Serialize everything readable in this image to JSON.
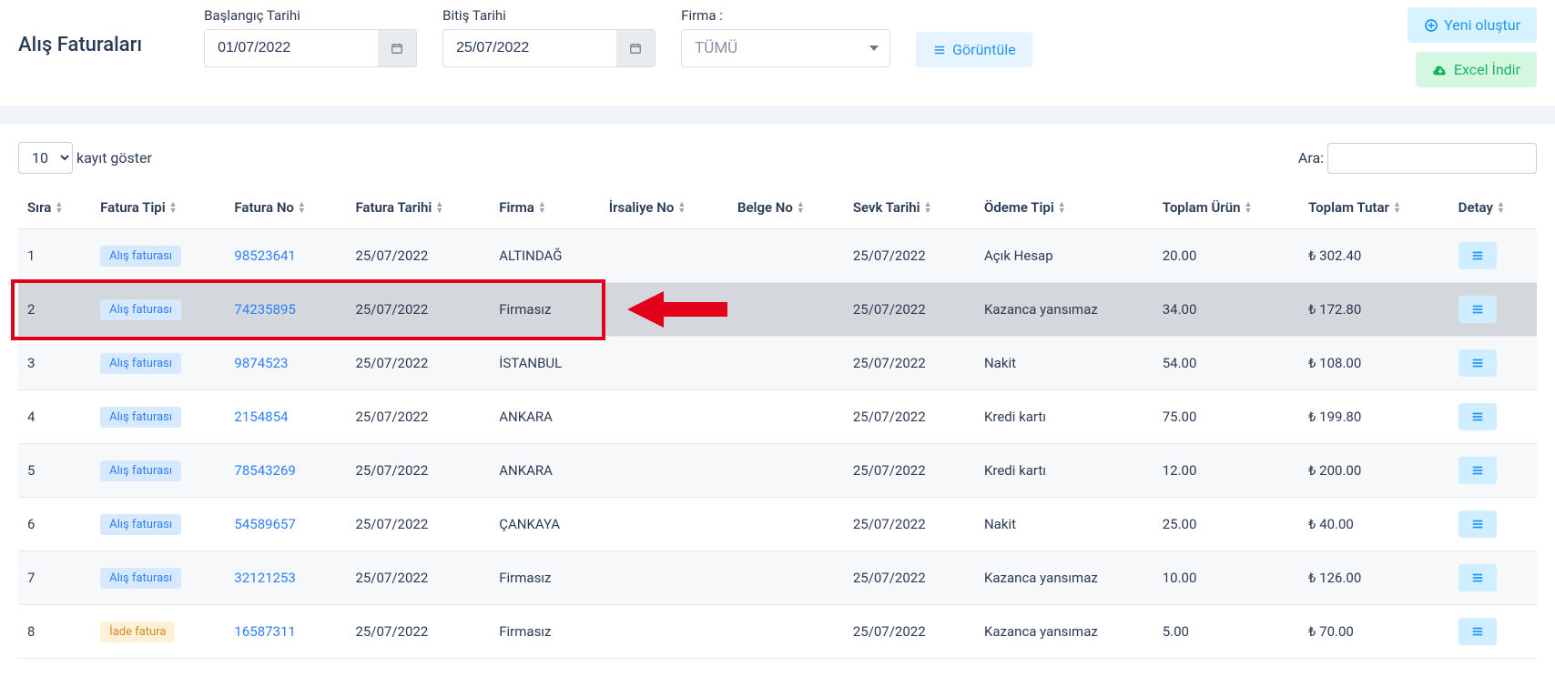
{
  "header": {
    "title": "Alış Faturaları",
    "start_label": "Başlangıç Tarihi",
    "end_label": "Bitiş Tarihi",
    "company_label": "Firma :",
    "start_value": "01/07/2022",
    "end_value": "25/07/2022",
    "company_selected": "TÜMÜ",
    "view_btn": "Görüntüle",
    "create_btn": "Yeni oluştur",
    "excel_btn": "Excel İndir"
  },
  "table_controls": {
    "length": "10",
    "length_suffix": "kayıt göster",
    "search_label": "Ara:"
  },
  "columns": [
    "Sıra",
    "Fatura Tipi",
    "Fatura No",
    "Fatura Tarihi",
    "Firma",
    "İrsaliye No",
    "Belge No",
    "Sevk Tarihi",
    "Ödeme Tipi",
    "Toplam Ürün",
    "Toplam Tutar",
    "Detay"
  ],
  "rows": [
    {
      "sira": "1",
      "tip": "Alış faturası",
      "tip_kind": "blue",
      "no": "98523641",
      "tarih": "25/07/2022",
      "firma": "ALTINDAĞ",
      "irsaliye": "",
      "belge": "",
      "sevk": "25/07/2022",
      "odeme": "Açık Hesap",
      "urun": "20.00",
      "tutar": "₺ 302.40",
      "highlight": false
    },
    {
      "sira": "2",
      "tip": "Alış faturası",
      "tip_kind": "blue",
      "no": "74235895",
      "tarih": "25/07/2022",
      "firma": "Firmasız",
      "irsaliye": "",
      "belge": "",
      "sevk": "25/07/2022",
      "odeme": "Kazanca yansımaz",
      "urun": "34.00",
      "tutar": "₺ 172.80",
      "highlight": true
    },
    {
      "sira": "3",
      "tip": "Alış faturası",
      "tip_kind": "blue",
      "no": "9874523",
      "tarih": "25/07/2022",
      "firma": "İSTANBUL",
      "irsaliye": "",
      "belge": "",
      "sevk": "25/07/2022",
      "odeme": "Nakit",
      "urun": "54.00",
      "tutar": "₺ 108.00",
      "highlight": false
    },
    {
      "sira": "4",
      "tip": "Alış faturası",
      "tip_kind": "blue",
      "no": "2154854",
      "tarih": "25/07/2022",
      "firma": "ANKARA",
      "irsaliye": "",
      "belge": "",
      "sevk": "25/07/2022",
      "odeme": "Kredi kartı",
      "urun": "75.00",
      "tutar": "₺ 199.80",
      "highlight": false
    },
    {
      "sira": "5",
      "tip": "Alış faturası",
      "tip_kind": "blue",
      "no": "78543269",
      "tarih": "25/07/2022",
      "firma": "ANKARA",
      "irsaliye": "",
      "belge": "",
      "sevk": "25/07/2022",
      "odeme": "Kredi kartı",
      "urun": "12.00",
      "tutar": "₺ 200.00",
      "highlight": false
    },
    {
      "sira": "6",
      "tip": "Alış faturası",
      "tip_kind": "blue",
      "no": "54589657",
      "tarih": "25/07/2022",
      "firma": "ÇANKAYA",
      "irsaliye": "",
      "belge": "",
      "sevk": "25/07/2022",
      "odeme": "Nakit",
      "urun": "25.00",
      "tutar": "₺ 40.00",
      "highlight": false
    },
    {
      "sira": "7",
      "tip": "Alış faturası",
      "tip_kind": "blue",
      "no": "32121253",
      "tarih": "25/07/2022",
      "firma": "Firmasız",
      "irsaliye": "",
      "belge": "",
      "sevk": "25/07/2022",
      "odeme": "Kazanca yansımaz",
      "urun": "10.00",
      "tutar": "₺ 126.00",
      "highlight": false
    },
    {
      "sira": "8",
      "tip": "İade fatura",
      "tip_kind": "orange",
      "no": "16587311",
      "tarih": "25/07/2022",
      "firma": "Firmasız",
      "irsaliye": "",
      "belge": "",
      "sevk": "25/07/2022",
      "odeme": "Kazanca yansımaz",
      "urun": "5.00",
      "tutar": "₺ 70.00",
      "highlight": false
    }
  ],
  "annotation": {
    "highlight_row_index": 1
  }
}
